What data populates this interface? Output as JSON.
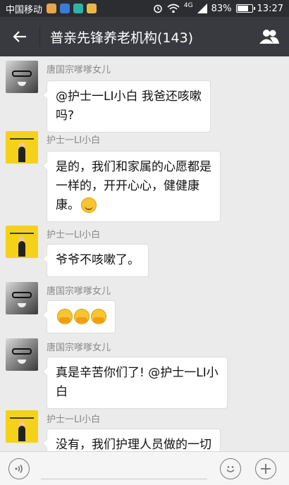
{
  "status_bar": {
    "carrier": "中国移动",
    "network": "4G",
    "battery": "83%",
    "battery_level": 0.83,
    "time": "13:27"
  },
  "header": {
    "title": "普亲先锋养老机构(143)"
  },
  "messages": [
    {
      "sender": "唐国宗嗲嗲女儿",
      "avatar": "baby-glasses-avatar",
      "lines": [
        "@护士一LI小白 我爸还咳嗽",
        "吗?"
      ]
    },
    {
      "sender": "护士一LI小白",
      "avatar": "nurse-avatar",
      "lines": [
        "是的，我们和家属的心愿都是",
        "一样的，开开心心，健健康",
        "康。"
      ],
      "emoji": "smile"
    },
    {
      "sender": "护士一LI小白",
      "avatar": "nurse-avatar",
      "lines": [
        "爷爷不咳嗽了。"
      ]
    },
    {
      "sender": "唐国宗嗲嗲女儿",
      "avatar": "baby-glasses-avatar",
      "lines": [],
      "emoji_count": 3
    },
    {
      "sender": "唐国宗嗲嗲女儿",
      "avatar": "baby-glasses-avatar",
      "lines": [
        "真是辛苦你们了! @护士一LI小",
        "白"
      ]
    },
    {
      "sender": "护士一LI小白",
      "avatar": "nurse-avatar",
      "lines": [
        "没有，我们护理人员做的一切"
      ]
    }
  ],
  "colors": {
    "status_bar_bg": "#2c2d31",
    "header_bg": "#393a3f",
    "chat_bg": "#ebebeb",
    "bubble_bg": "#ffffff"
  }
}
